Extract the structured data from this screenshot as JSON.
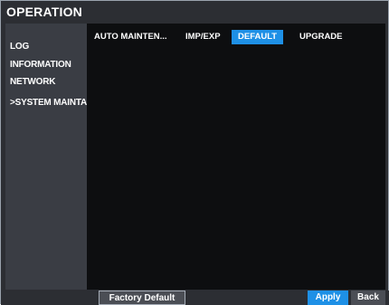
{
  "window": {
    "title": "OPERATION"
  },
  "sidebar": {
    "items": [
      {
        "label": "LOG"
      },
      {
        "label": "INFORMATION"
      },
      {
        "label": "NETWORK"
      },
      {
        "label": ">SYSTEM MAINTAIN"
      }
    ]
  },
  "tabs": [
    {
      "label": "AUTO MAINTEN..."
    },
    {
      "label": "IMP/EXP"
    },
    {
      "label": "DEFAULT",
      "active": true
    },
    {
      "label": "UPGRADE"
    }
  ],
  "footer": {
    "factory_default_label": "Factory Default",
    "apply_label": "Apply",
    "back_label": "Back"
  },
  "colors": {
    "accent": "#1e90e6",
    "window_bg": "#2c2e33",
    "sidebar_bg": "#3a3d44",
    "content_bg": "#0d0e10"
  }
}
